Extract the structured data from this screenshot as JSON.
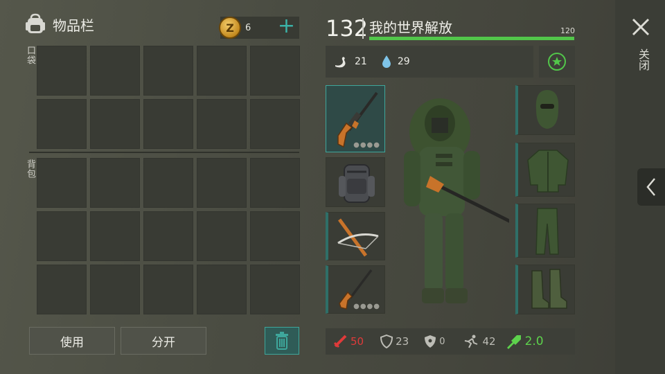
{
  "inventory": {
    "title": "物品栏",
    "coins": "6",
    "pocket_label": "口袋",
    "backpack_label": "背包"
  },
  "buttons": {
    "use": "使用",
    "split": "分开"
  },
  "character": {
    "level": "132",
    "name": "我的世界解放",
    "xp_max": "120",
    "xp_progress": 1.0,
    "hunger": "21",
    "thirst": "29"
  },
  "bottom_stats": {
    "attack": "50",
    "defense": "23",
    "radiation": "0",
    "speed": "42",
    "weight": "2.0"
  },
  "close": {
    "label": "关闭"
  },
  "colors": {
    "accent": "#3ea79c",
    "xp": "#52c64a",
    "attack": "#e03a3a",
    "weight": "#5dd24c"
  }
}
